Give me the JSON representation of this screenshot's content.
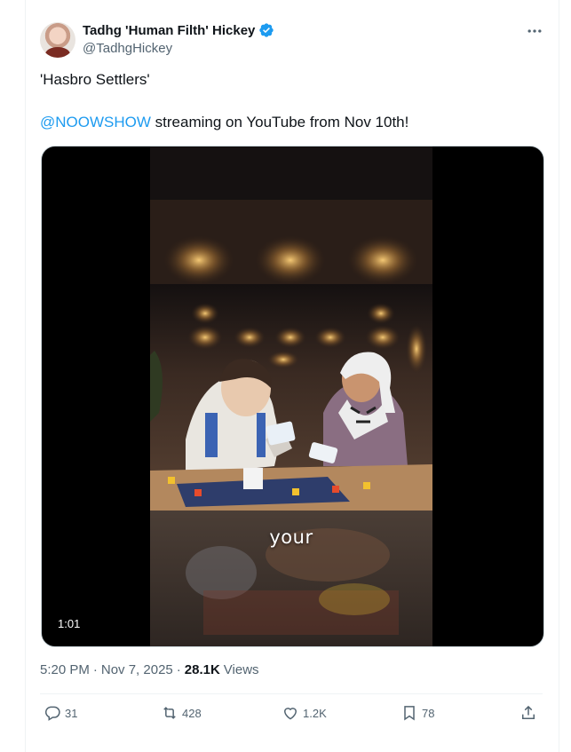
{
  "tweet": {
    "display_name": "Tadhg 'Human Filth' Hickey",
    "handle": "@TadhgHickey",
    "verified": true,
    "more_icon": "more-horizontal-icon",
    "text_line1": "'Hasbro Settlers'",
    "mention": "@NOOWSHOW",
    "text_line2_rest": " streaming on YouTube from Nov 10th!",
    "media": {
      "duration": "1:01",
      "caption": "your"
    },
    "meta": {
      "time": "5:20 PM",
      "separator1": "·",
      "date": "Nov 7, 2025",
      "separator2": "·",
      "views_count": "28.1K",
      "views_label": "Views"
    },
    "actions": {
      "replies": "31",
      "retweets": "428",
      "likes": "1.2K",
      "bookmarks": "78"
    }
  },
  "colors": {
    "accent": "#1d9bf0",
    "secondary_text": "#536471",
    "primary_text": "#0f1419"
  }
}
